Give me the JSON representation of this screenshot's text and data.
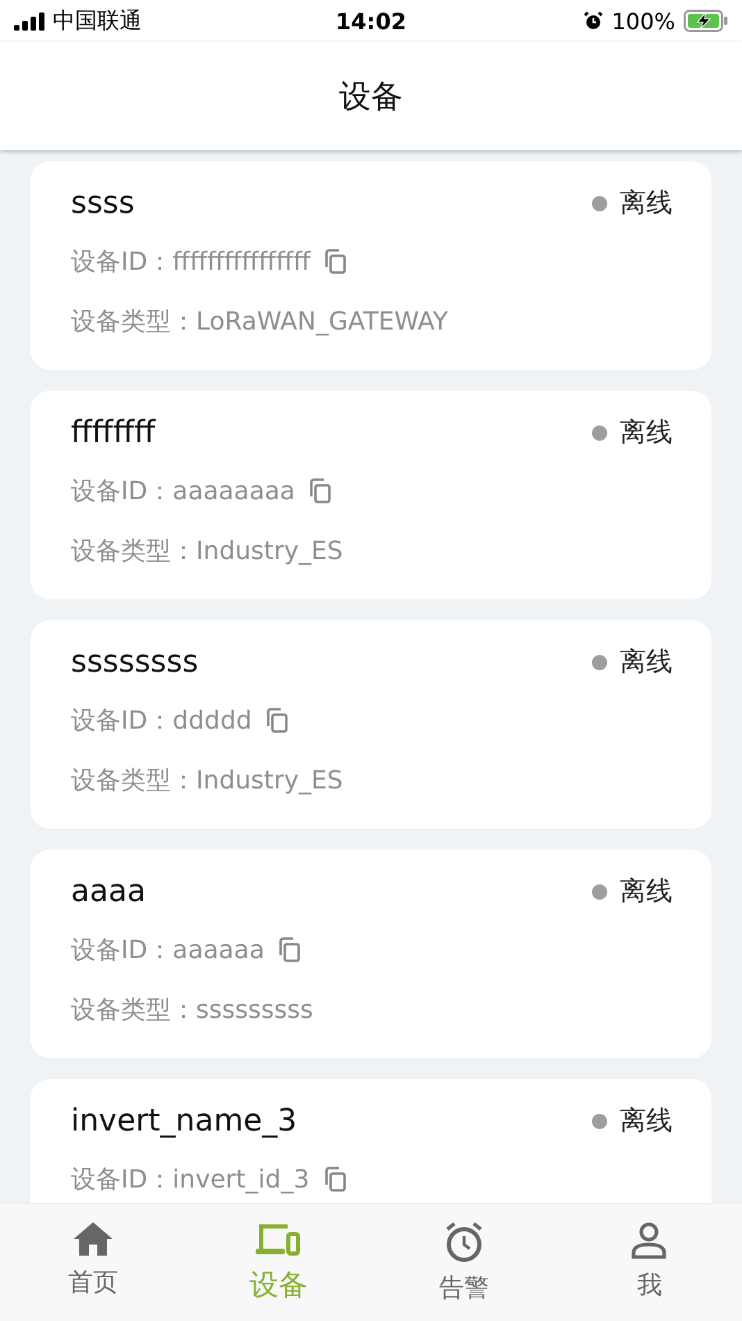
{
  "status_bar": {
    "carrier": "中国联通",
    "time": "14:02",
    "battery": "100%"
  },
  "header": {
    "title": "设备"
  },
  "devices": [
    {
      "name": "ssss",
      "status": "离线",
      "online": false,
      "id_line": "设备ID：ffffffffffffffff",
      "type_line": "设备类型：LoRaWAN_GATEWAY"
    },
    {
      "name": "ffffffff",
      "status": "离线",
      "online": false,
      "id_line": "设备ID：aaaaaaaa",
      "type_line": "设备类型：Industry_ES"
    },
    {
      "name": "ssssssss",
      "status": "离线",
      "online": false,
      "id_line": "设备ID：ddddd",
      "type_line": "设备类型：Industry_ES"
    },
    {
      "name": "aaaa",
      "status": "离线",
      "online": false,
      "id_line": "设备ID：aaaaaa",
      "type_line": "设备类型：sssssssss"
    },
    {
      "name": "invert_name_3",
      "status": "离线",
      "online": false,
      "id_line": "设备ID：invert_id_3"
    }
  ],
  "tab_bar": [
    {
      "kind": "home",
      "label": "首页",
      "selected": false
    },
    {
      "kind": "devices",
      "label": "设备",
      "selected": true
    },
    {
      "kind": "alarm",
      "label": "告警",
      "selected": false
    },
    {
      "kind": "person",
      "label": "我",
      "selected": false
    }
  ]
}
